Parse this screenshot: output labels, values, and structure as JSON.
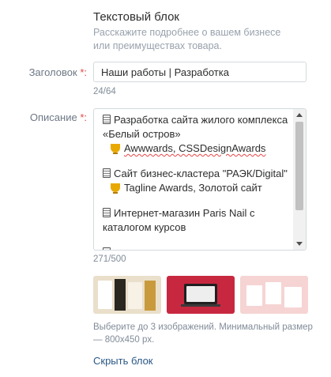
{
  "section": {
    "title": "Текстовый блок",
    "hint": "Расскажите подробнее о вашем бизнесе или преимуществах товара."
  },
  "title_field": {
    "label": "Заголовок",
    "required_mark": "*:",
    "value": "Наши работы | Разработка",
    "counter": "24/64"
  },
  "description_field": {
    "label": "Описание",
    "required_mark": "*:",
    "counter": "271/500",
    "items": [
      {
        "icon": "memo-icon",
        "lines": [
          "Разработка сайта жилого комплекса",
          "«Белый остров»"
        ],
        "award_icon": "trophy-icon",
        "award": "Awwwards, CSSDesignAwards"
      },
      {
        "icon": "memo-icon",
        "lines": [
          "Сайт бизнес-кластера \"РАЭК/Digital\""
        ],
        "award_icon": "trophy-icon",
        "award": "Tagline Awards, Золотой сайт"
      },
      {
        "icon": "memo-icon",
        "lines": [
          "Интернет-магазин Paris Nail с",
          "каталогом курсов"
        ]
      }
    ]
  },
  "images": {
    "hint": "Выберите до 3 изображений. Минимальный размер — 800x450 px.",
    "items": [
      {
        "name": "image-thumbnail-1",
        "color": "#eadfca"
      },
      {
        "name": "image-thumbnail-2",
        "color": "#c8283f"
      },
      {
        "name": "image-thumbnail-3",
        "color": "#f6d4d4"
      }
    ]
  },
  "hide_link": "Скрыть блок",
  "colors": {
    "link": "#2a5885",
    "required": "#e64646",
    "muted": "#818c99"
  }
}
